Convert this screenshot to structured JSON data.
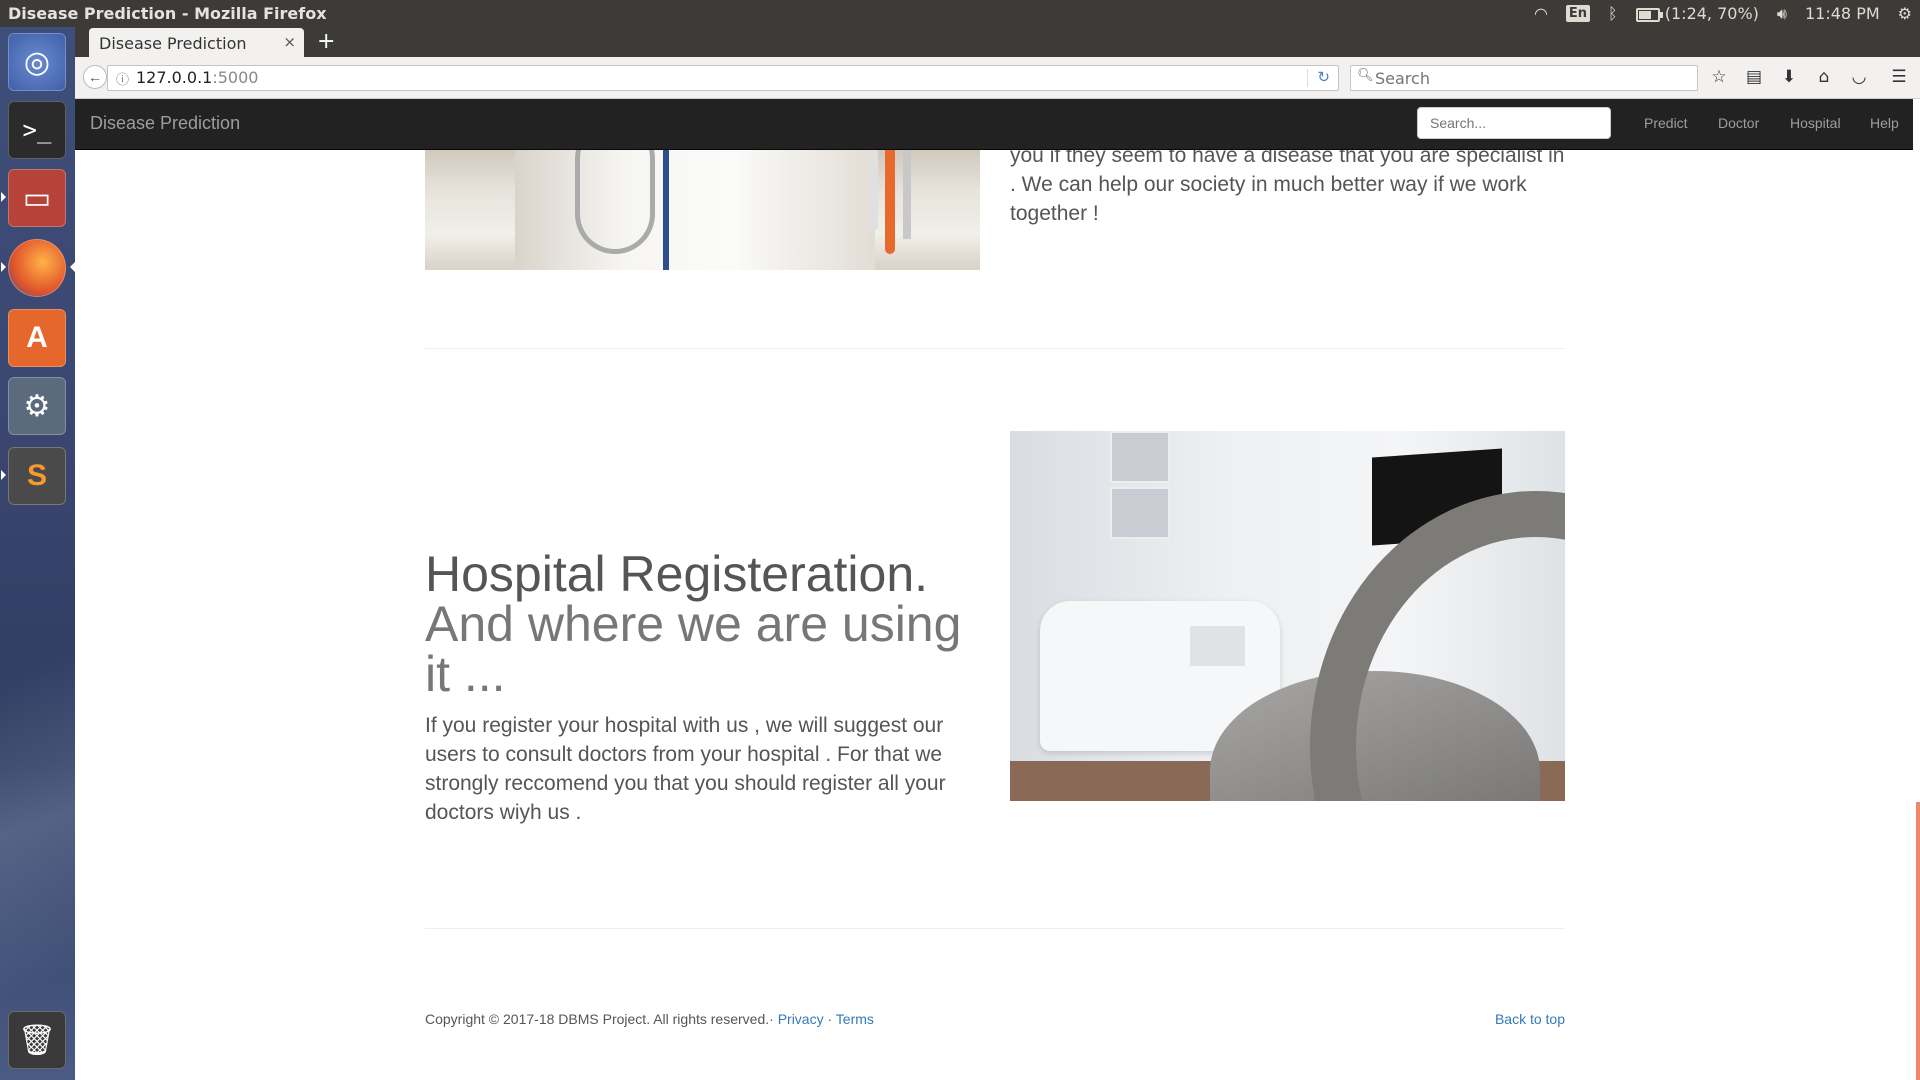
{
  "os": {
    "window_title": "Disease Prediction - Mozilla Firefox",
    "keyboard_layout": "En",
    "battery_text": "(1:24, 70%)",
    "battery_level": 0.7,
    "clock": "11:48 PM"
  },
  "launcher": {
    "items": [
      "ubuntu-dash",
      "terminal",
      "files",
      "firefox",
      "software-center",
      "system-settings",
      "sublime-text",
      "trash"
    ]
  },
  "browser": {
    "tab_title": "Disease Prediction",
    "tab_close": "×",
    "new_tab": "+",
    "url_host": "127.0.0.1",
    "url_port": ":5000",
    "search_placeholder": "Search"
  },
  "site_nav": {
    "brand": "Disease Prediction",
    "search_placeholder": "Search...",
    "links": [
      "Predict",
      "Doctor",
      "Hospital",
      "Help"
    ]
  },
  "content": {
    "doctor_text": "By registering with us , we will suggest our users to consult you if they seem to have a disease that you are specialist in . We can help our society in much better way if we work together !",
    "hospital_heading": "Hospital Registeration.",
    "hospital_subheading": "And where we are using it ...",
    "hospital_paragraph": "If you register your hospital with us , we will suggest our users to consult doctors from your hospital . For that we strongly reccomend you that you should register all your doctors wiyh us ."
  },
  "footer": {
    "copyright": "Copyright © 2017-18 DBMS Project. All rights reserved.·",
    "privacy": "Privacy",
    "sep": "·",
    "terms": "Terms",
    "back_to_top": "Back to top"
  },
  "colors": {
    "navbar_bg": "#222222",
    "link": "#337ab7",
    "panel_bg": "#3c3b37"
  }
}
